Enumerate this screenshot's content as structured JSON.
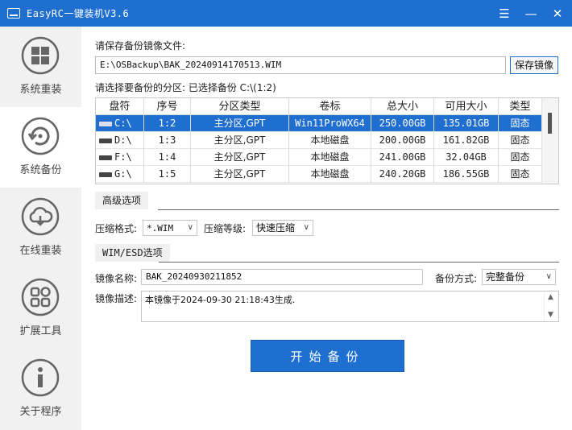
{
  "window": {
    "title": "EasyRC一键装机V3.6",
    "menu_icon": "☰",
    "minimize": "—",
    "close": "✕"
  },
  "sidebar": {
    "items": [
      {
        "label": "系统重装",
        "icon": "windows-logo-icon"
      },
      {
        "label": "系统备份",
        "icon": "backup-restore-icon"
      },
      {
        "label": "在线重装",
        "icon": "cloud-download-icon"
      },
      {
        "label": "扩展工具",
        "icon": "grid-tools-icon"
      },
      {
        "label": "关于程序",
        "icon": "info-icon"
      }
    ],
    "active_index": 1
  },
  "backup_file": {
    "label": "请保存备份镜像文件:",
    "path": "E:\\OSBackup\\BAK_20240914170513.WIM",
    "save_button": "保存镜像"
  },
  "partition": {
    "label": "请选择要备份的分区: 已选择备份 C:\\(1:2)",
    "columns": [
      "盘符",
      "序号",
      "分区类型",
      "卷标",
      "总大小",
      "可用大小",
      "类型"
    ],
    "rows": [
      {
        "drive": "C:\\",
        "index": "1:2",
        "ptype": "主分区,GPT",
        "volume": "Win11ProWX64",
        "total": "250.00GB",
        "free": "135.01GB",
        "kind": "固态",
        "selected": true
      },
      {
        "drive": "D:\\",
        "index": "1:3",
        "ptype": "主分区,GPT",
        "volume": "本地磁盘",
        "total": "200.00GB",
        "free": "161.82GB",
        "kind": "固态",
        "selected": false
      },
      {
        "drive": "F:\\",
        "index": "1:4",
        "ptype": "主分区,GPT",
        "volume": "本地磁盘",
        "total": "241.00GB",
        "free": "32.04GB",
        "kind": "固态",
        "selected": false
      },
      {
        "drive": "G:\\",
        "index": "1:5",
        "ptype": "主分区,GPT",
        "volume": "本地磁盘",
        "total": "240.20GB",
        "free": "186.55GB",
        "kind": "固态",
        "selected": false
      }
    ]
  },
  "advanced": {
    "tab": "高级选项",
    "format_label": "压缩格式:",
    "format_value": "*.WIM",
    "level_label": "压缩等级:",
    "level_value": "快速压缩"
  },
  "wim": {
    "tab": "WIM/ESD选项",
    "name_label": "镜像名称:",
    "name_value": "BAK_20240930211852",
    "mode_label": "备份方式:",
    "mode_value": "完整备份",
    "desc_label": "镜像描述:",
    "desc_value": "本镜像于2024-09-30 21:18:43生成."
  },
  "start_button": "开始备份"
}
